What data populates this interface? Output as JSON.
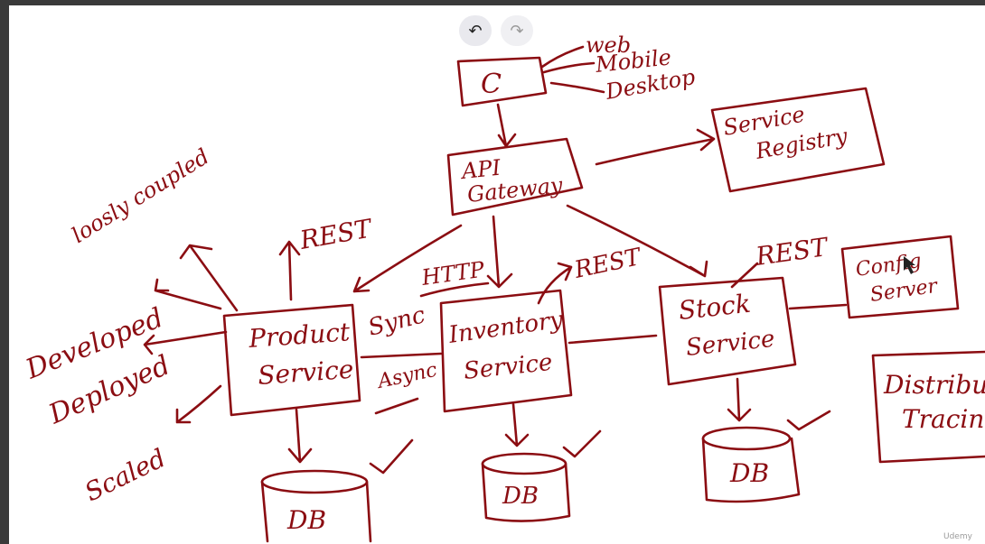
{
  "toolbar": {
    "undo_icon": "undo-icon",
    "redo_icon": "redo-icon",
    "undo_glyph": "↶",
    "redo_glyph": "↷"
  },
  "diagram": {
    "ink_color": "#8b0d12",
    "client": {
      "label": "C",
      "types": [
        "web",
        "Mobile",
        "Desktop"
      ]
    },
    "api_gateway": {
      "line1": "API",
      "line2": "Gateway"
    },
    "service_registry": {
      "line1": "Service",
      "line2": "Registry"
    },
    "loosely_coupled": "loosly coupled",
    "rest_left": "REST",
    "rest_mid": "REST",
    "rest_right": "REST",
    "qualities": [
      "Developed",
      "Deployed",
      "Scaled"
    ],
    "product_service": {
      "line1": "Product",
      "line2": "Service"
    },
    "inventory_service": {
      "line1": "Inventory",
      "line2": "Service"
    },
    "stock_service": {
      "line1": "Stock",
      "line2": "Service"
    },
    "config_server": {
      "line1": "Config",
      "line2": "Server"
    },
    "distributed_tracing": {
      "line1": "Distribu",
      "line2": "Tracin"
    },
    "http": "HTTP",
    "sync": "Sync",
    "async": "Async",
    "db_label": "DB"
  },
  "watermark": "Udemy"
}
